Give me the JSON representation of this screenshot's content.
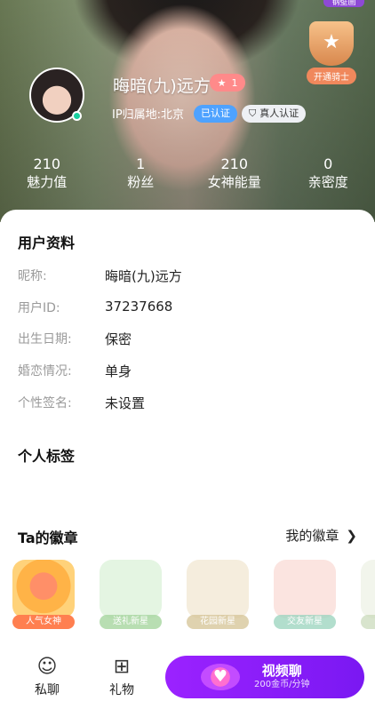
{
  "header": {
    "top_badge": "钢壁画",
    "nickname": "晦暗(九)远方",
    "level": "1",
    "location": "IP归属地:北京",
    "verified": "已认证",
    "real_person": "真人认证",
    "knight_label": "开通骑士"
  },
  "stats": [
    {
      "value": "210",
      "label": "魅力值"
    },
    {
      "value": "1",
      "label": "粉丝"
    },
    {
      "value": "210",
      "label": "女神能量"
    },
    {
      "value": "0",
      "label": "亲密度"
    }
  ],
  "profile": {
    "title": "用户资料",
    "rows": [
      {
        "key": "昵称:",
        "value": "晦暗(九)远方"
      },
      {
        "key": "用户ID:",
        "value": "37237668"
      },
      {
        "key": "出生日期:",
        "value": "保密"
      },
      {
        "key": "婚恋情况:",
        "value": "单身"
      },
      {
        "key": "个性签名:",
        "value": "未设置"
      }
    ]
  },
  "tags": {
    "title": "个人标签"
  },
  "badges": {
    "title": "Ta的徽章",
    "more": "我的徽章",
    "items": [
      {
        "name": "人气女神"
      },
      {
        "name": "送礼新星"
      },
      {
        "name": "花园新星"
      },
      {
        "name": "交友新星"
      },
      {
        "name": ""
      }
    ]
  },
  "bottom": {
    "chat": "私聊",
    "gift": "礼物",
    "video": "视频聊",
    "price": "200金币/分钟"
  },
  "icons": [
    "star-icon",
    "shield-icon",
    "trophy-icon",
    "chevron-right-icon",
    "chat-bubble-icon",
    "gift-icon",
    "heart-icon"
  ],
  "colors": {
    "accent": "#8a1ef5",
    "verified": "#4ea2ff",
    "online": "#19d1a0",
    "knight": "#f0885c"
  }
}
